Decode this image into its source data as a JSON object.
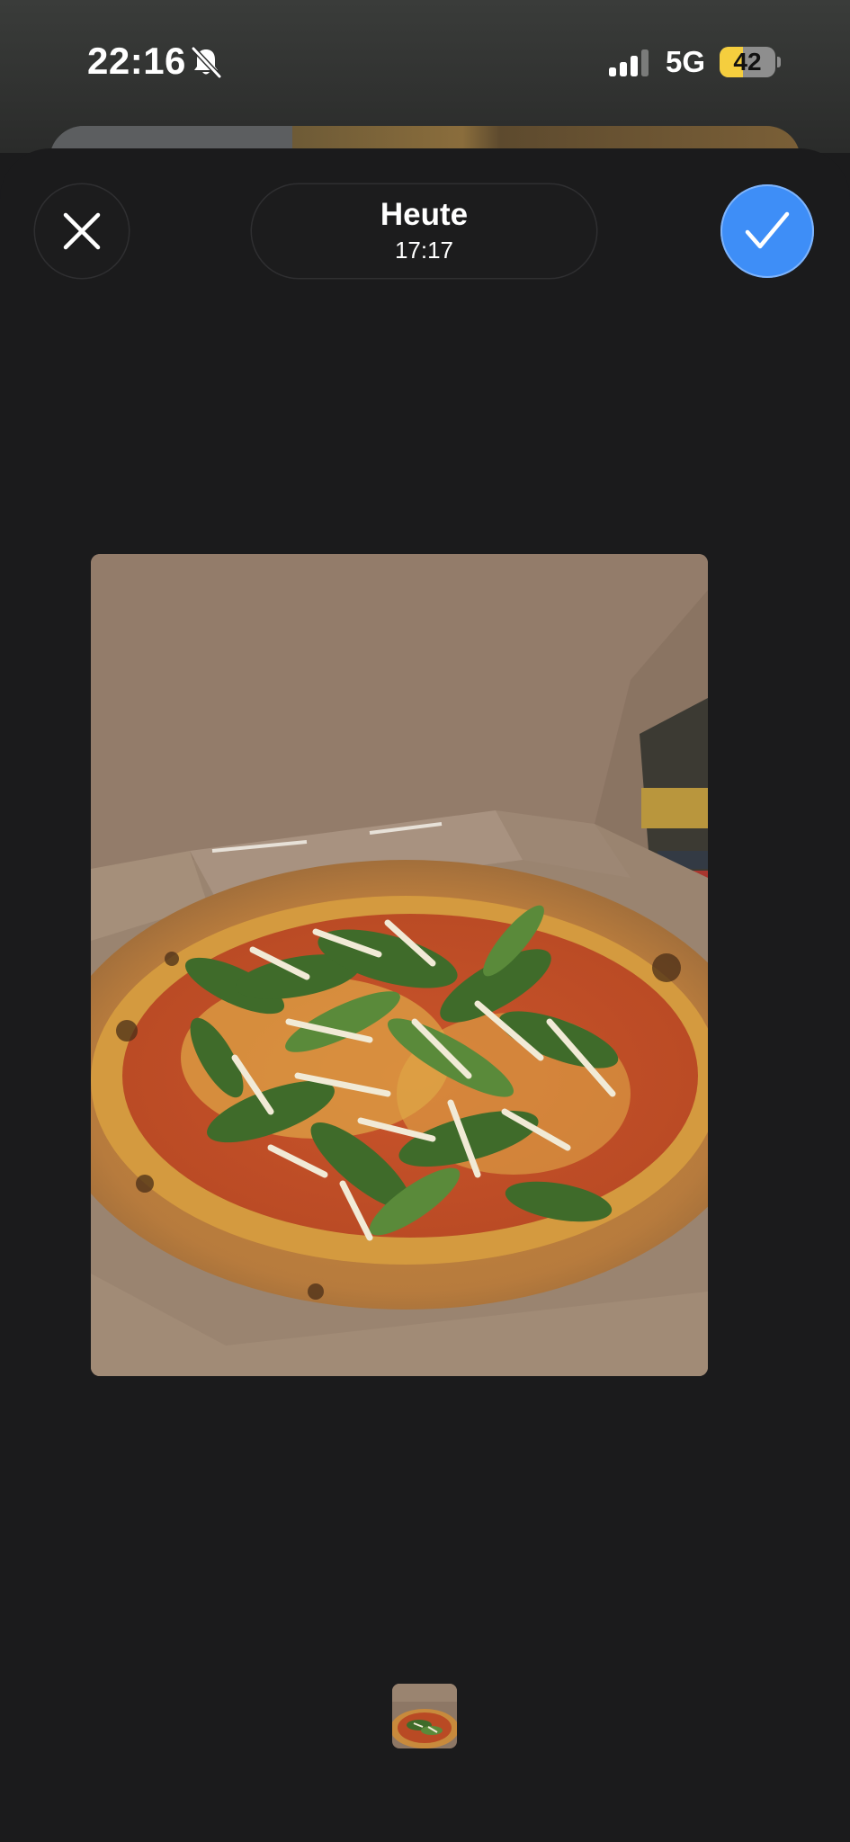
{
  "status_bar": {
    "time": "22:16",
    "silent_icon": "bell-slash-icon",
    "signal_icon": "cellular-signal-icon",
    "network": "5G",
    "battery_level": 42,
    "battery_text": "42",
    "battery_color": "#f5ce3e"
  },
  "header": {
    "close_icon": "close-icon",
    "date_title": "Heute",
    "date_time": "17:17",
    "confirm_icon": "checkmark-icon",
    "accent_color": "#3e8ef7"
  },
  "photo": {
    "subject_icon": "pizza-photo"
  },
  "thumbnail_strip": {
    "count": 1,
    "selected_index": 0
  }
}
